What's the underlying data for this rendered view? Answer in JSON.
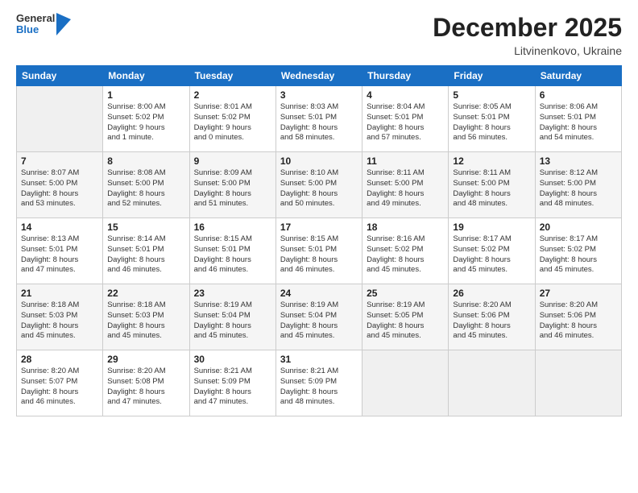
{
  "header": {
    "logo_general": "General",
    "logo_blue": "Blue",
    "month_year": "December 2025",
    "location": "Litvinenkovo, Ukraine"
  },
  "days_of_week": [
    "Sunday",
    "Monday",
    "Tuesday",
    "Wednesday",
    "Thursday",
    "Friday",
    "Saturday"
  ],
  "weeks": [
    [
      {
        "day": "",
        "info": ""
      },
      {
        "day": "1",
        "info": "Sunrise: 8:00 AM\nSunset: 5:02 PM\nDaylight: 9 hours\nand 1 minute."
      },
      {
        "day": "2",
        "info": "Sunrise: 8:01 AM\nSunset: 5:02 PM\nDaylight: 9 hours\nand 0 minutes."
      },
      {
        "day": "3",
        "info": "Sunrise: 8:03 AM\nSunset: 5:01 PM\nDaylight: 8 hours\nand 58 minutes."
      },
      {
        "day": "4",
        "info": "Sunrise: 8:04 AM\nSunset: 5:01 PM\nDaylight: 8 hours\nand 57 minutes."
      },
      {
        "day": "5",
        "info": "Sunrise: 8:05 AM\nSunset: 5:01 PM\nDaylight: 8 hours\nand 56 minutes."
      },
      {
        "day": "6",
        "info": "Sunrise: 8:06 AM\nSunset: 5:01 PM\nDaylight: 8 hours\nand 54 minutes."
      }
    ],
    [
      {
        "day": "7",
        "info": "Sunrise: 8:07 AM\nSunset: 5:00 PM\nDaylight: 8 hours\nand 53 minutes."
      },
      {
        "day": "8",
        "info": "Sunrise: 8:08 AM\nSunset: 5:00 PM\nDaylight: 8 hours\nand 52 minutes."
      },
      {
        "day": "9",
        "info": "Sunrise: 8:09 AM\nSunset: 5:00 PM\nDaylight: 8 hours\nand 51 minutes."
      },
      {
        "day": "10",
        "info": "Sunrise: 8:10 AM\nSunset: 5:00 PM\nDaylight: 8 hours\nand 50 minutes."
      },
      {
        "day": "11",
        "info": "Sunrise: 8:11 AM\nSunset: 5:00 PM\nDaylight: 8 hours\nand 49 minutes."
      },
      {
        "day": "12",
        "info": "Sunrise: 8:11 AM\nSunset: 5:00 PM\nDaylight: 8 hours\nand 48 minutes."
      },
      {
        "day": "13",
        "info": "Sunrise: 8:12 AM\nSunset: 5:00 PM\nDaylight: 8 hours\nand 48 minutes."
      }
    ],
    [
      {
        "day": "14",
        "info": "Sunrise: 8:13 AM\nSunset: 5:01 PM\nDaylight: 8 hours\nand 47 minutes."
      },
      {
        "day": "15",
        "info": "Sunrise: 8:14 AM\nSunset: 5:01 PM\nDaylight: 8 hours\nand 46 minutes."
      },
      {
        "day": "16",
        "info": "Sunrise: 8:15 AM\nSunset: 5:01 PM\nDaylight: 8 hours\nand 46 minutes."
      },
      {
        "day": "17",
        "info": "Sunrise: 8:15 AM\nSunset: 5:01 PM\nDaylight: 8 hours\nand 46 minutes."
      },
      {
        "day": "18",
        "info": "Sunrise: 8:16 AM\nSunset: 5:02 PM\nDaylight: 8 hours\nand 45 minutes."
      },
      {
        "day": "19",
        "info": "Sunrise: 8:17 AM\nSunset: 5:02 PM\nDaylight: 8 hours\nand 45 minutes."
      },
      {
        "day": "20",
        "info": "Sunrise: 8:17 AM\nSunset: 5:02 PM\nDaylight: 8 hours\nand 45 minutes."
      }
    ],
    [
      {
        "day": "21",
        "info": "Sunrise: 8:18 AM\nSunset: 5:03 PM\nDaylight: 8 hours\nand 45 minutes."
      },
      {
        "day": "22",
        "info": "Sunrise: 8:18 AM\nSunset: 5:03 PM\nDaylight: 8 hours\nand 45 minutes."
      },
      {
        "day": "23",
        "info": "Sunrise: 8:19 AM\nSunset: 5:04 PM\nDaylight: 8 hours\nand 45 minutes."
      },
      {
        "day": "24",
        "info": "Sunrise: 8:19 AM\nSunset: 5:04 PM\nDaylight: 8 hours\nand 45 minutes."
      },
      {
        "day": "25",
        "info": "Sunrise: 8:19 AM\nSunset: 5:05 PM\nDaylight: 8 hours\nand 45 minutes."
      },
      {
        "day": "26",
        "info": "Sunrise: 8:20 AM\nSunset: 5:06 PM\nDaylight: 8 hours\nand 45 minutes."
      },
      {
        "day": "27",
        "info": "Sunrise: 8:20 AM\nSunset: 5:06 PM\nDaylight: 8 hours\nand 46 minutes."
      }
    ],
    [
      {
        "day": "28",
        "info": "Sunrise: 8:20 AM\nSunset: 5:07 PM\nDaylight: 8 hours\nand 46 minutes."
      },
      {
        "day": "29",
        "info": "Sunrise: 8:20 AM\nSunset: 5:08 PM\nDaylight: 8 hours\nand 47 minutes."
      },
      {
        "day": "30",
        "info": "Sunrise: 8:21 AM\nSunset: 5:09 PM\nDaylight: 8 hours\nand 47 minutes."
      },
      {
        "day": "31",
        "info": "Sunrise: 8:21 AM\nSunset: 5:09 PM\nDaylight: 8 hours\nand 48 minutes."
      },
      {
        "day": "",
        "info": ""
      },
      {
        "day": "",
        "info": ""
      },
      {
        "day": "",
        "info": ""
      }
    ]
  ]
}
